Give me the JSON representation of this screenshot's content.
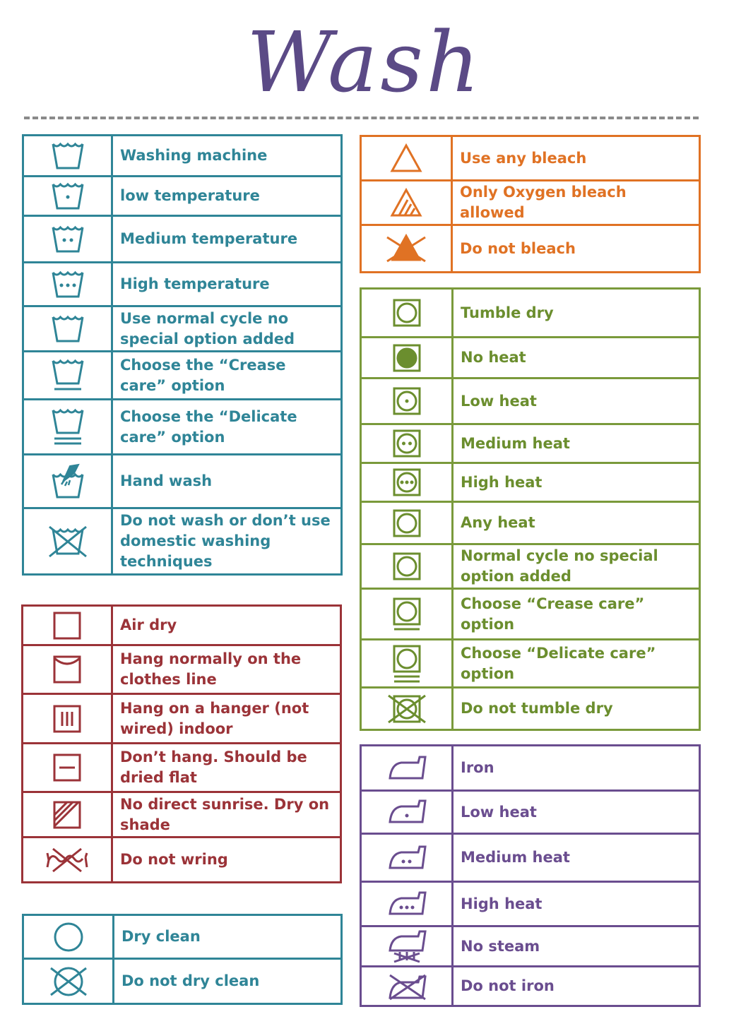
{
  "title": "Wash",
  "colors": {
    "title": "#5b4a86",
    "wash": "#2f8597",
    "dry": "#9b3338",
    "bleach": "#e07224",
    "tumble": "#7a9a3b",
    "iron": "#6a4d8f",
    "dryclean": "#2f8597"
  },
  "wash": [
    {
      "icon": "washtub-icon",
      "label": "Washing machine"
    },
    {
      "icon": "washtub-one-dot-icon",
      "label": "low temperature"
    },
    {
      "icon": "washtub-two-dots-icon",
      "label": "Medium temperature"
    },
    {
      "icon": "washtub-three-dots-icon",
      "label": "High temperature"
    },
    {
      "icon": "washtub-icon",
      "label": "Use normal cycle no special option added"
    },
    {
      "icon": "washtub-one-bar-icon",
      "label": "Choose the “Crease care” option"
    },
    {
      "icon": "washtub-two-bars-icon",
      "label": "Choose the “Delicate care” option"
    },
    {
      "icon": "hand-wash-icon",
      "label": "Hand wash"
    },
    {
      "icon": "do-not-wash-icon",
      "label": "Do not wash or don’t use domestic washing techniques"
    }
  ],
  "dry": [
    {
      "icon": "square-icon",
      "label": "Air dry"
    },
    {
      "icon": "line-dry-icon",
      "label": "Hang normally on the clothes line"
    },
    {
      "icon": "drip-dry-icon",
      "label": "Hang on a hanger (not wired) indoor"
    },
    {
      "icon": "dry-flat-icon",
      "label": "Don’t hang. Should be dried flat"
    },
    {
      "icon": "dry-in-shade-icon",
      "label": "No direct sunrise. Dry on shade"
    },
    {
      "icon": "do-not-wring-icon",
      "label": "Do not wring"
    }
  ],
  "dryclean": [
    {
      "icon": "circle-icon",
      "label": "Dry clean"
    },
    {
      "icon": "do-not-dry-clean-icon",
      "label": "Do not dry clean"
    }
  ],
  "bleach": [
    {
      "icon": "triangle-icon",
      "label": "Use any bleach"
    },
    {
      "icon": "triangle-stripes-icon",
      "label": "Only Oxygen bleach allowed"
    },
    {
      "icon": "do-not-bleach-icon",
      "label": "Do not bleach"
    }
  ],
  "tumble": [
    {
      "icon": "tumble-dry-icon",
      "label": "Tumble dry"
    },
    {
      "icon": "tumble-filled-icon",
      "label": "No heat"
    },
    {
      "icon": "tumble-one-dot-icon",
      "label": "Low heat"
    },
    {
      "icon": "tumble-two-dots-icon",
      "label": "Medium heat"
    },
    {
      "icon": "tumble-three-dots-icon",
      "label": "High heat"
    },
    {
      "icon": "tumble-dry-icon",
      "label": "Any heat"
    },
    {
      "icon": "tumble-dry-icon",
      "label": "Normal cycle no special option added"
    },
    {
      "icon": "tumble-one-bar-icon",
      "label": "Choose “Crease care” option"
    },
    {
      "icon": "tumble-two-bars-icon",
      "label": "Choose “Delicate care” option"
    },
    {
      "icon": "do-not-tumble-dry-icon",
      "label": "Do not tumble dry"
    }
  ],
  "iron": [
    {
      "icon": "iron-icon",
      "label": "Iron"
    },
    {
      "icon": "iron-one-dot-icon",
      "label": "Low heat"
    },
    {
      "icon": "iron-two-dots-icon",
      "label": "Medium heat"
    },
    {
      "icon": "iron-three-dots-icon",
      "label": "High heat"
    },
    {
      "icon": "iron-no-steam-icon",
      "label": "No steam"
    },
    {
      "icon": "do-not-iron-icon",
      "label": "Do not iron"
    }
  ]
}
